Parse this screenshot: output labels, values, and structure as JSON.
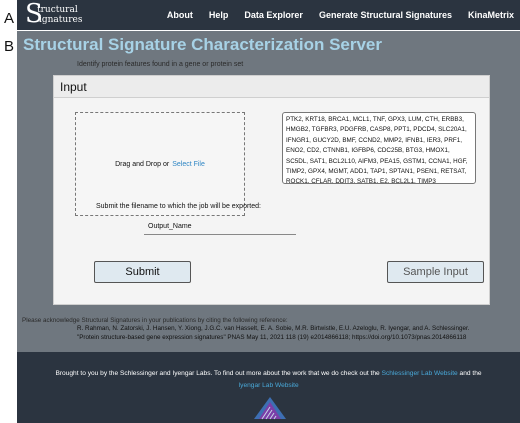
{
  "panel_labels": {
    "a": "A",
    "b": "B"
  },
  "logo": {
    "letter": "S",
    "word1": "tructural",
    "word2": "ignatures"
  },
  "nav": {
    "items": [
      "About",
      "Help",
      "Data Explorer",
      "Generate Structural Signatures",
      "KinaMetrix"
    ]
  },
  "main": {
    "title": "Structural Signature Characterization Server",
    "subtitle": "Identify protein features found in a gene or protein set"
  },
  "input_card": {
    "header": "Input",
    "drop_text": "Drag and Drop or",
    "select_file": "Select File",
    "gene_list": "PTK2, KRT18, BRCA1, MCL1, TNF, GPX3, LUM, CTH, ERBB3, HMGB2, TGFBR3, PDGFRB, CASP8, PPT1, PDCD4, SLC20A1, IFNGR1, GUCY2D, BMF, CCND2, MMP2, IFNB1, IER3, PRF1, ENO2, CD2, CTNNB1, IGFBP6, CDC25B, BTG3, HMOX1, SC5DL, SAT1, BCL2L10, AIFM3, PEA15, GSTM1, CCNA1, HGF, TIMP2, GPX4, MGMT, ADD1, TAP1, SPTAN1, PSEN1, RETSAT, ROCK1, CFLAR, DDIT3, SATB1, E2, BCL2L1, TIMP3",
    "filename_label": "Submit the filename to which the job will be exported:",
    "filename_value": "Output_Name",
    "submit_label": "Submit",
    "sample_label": "Sample Input"
  },
  "acknowledgement": {
    "intro": "Please acknowledge Structural Signatures in your publications by citing the following reference:",
    "authors": "R. Rahman, N. Zatorski, J. Hansen, Y. Xiong, J.G.C. van Hasselt, E. A. Sobie, M.R. Birtwistle, E.U. Azeloglu, R. Iyengar, and A. Schlessinger.",
    "citation": "\"Protein structure-based gene expression signatures\" PNAS May 11, 2021 118 (19) e2014866118; https://doi.org/10.1073/pnas.2014866118"
  },
  "footer": {
    "text_before": "Brought to you by the Schlessinger and Iyengar Labs. To find out more about the work that we do check out the",
    "link1": "Schlessinger Lab Website",
    "text_mid": "and the",
    "link2": "Iyengar Lab Website"
  },
  "colors": {
    "nav_bg": "#2b3440",
    "main_bg": "#6f777f",
    "title": "#a7d2e6",
    "link": "#2f86c4",
    "footer_link": "#49a8d8"
  }
}
